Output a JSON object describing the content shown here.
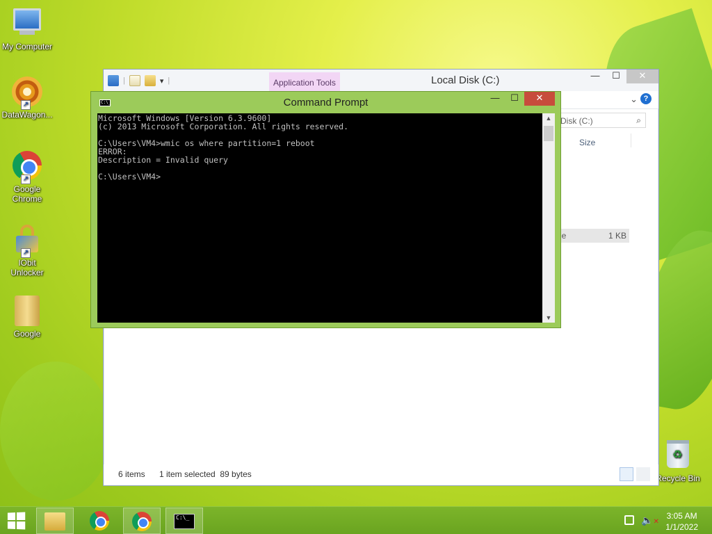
{
  "desktop": {
    "icons": [
      {
        "label": "My Computer"
      },
      {
        "label": "DataWagon..."
      },
      {
        "label": "Google Chrome"
      },
      {
        "label": "IObit Unlocker"
      },
      {
        "label": "Google"
      },
      {
        "label": "Recycle Bin"
      }
    ]
  },
  "explorer": {
    "contextual_tab": "Application Tools",
    "title": "Local Disk (C:)",
    "minimize": "—",
    "maximize": "☐",
    "close": "✕",
    "search_text": "Disk (C:)",
    "column_size": "Size",
    "selected_row": {
      "type_fragment": "le",
      "size": "1 KB"
    },
    "status": {
      "items": "6 items",
      "selection": "1 item selected  89 bytes"
    }
  },
  "cmd": {
    "title": "Command Prompt",
    "icon_text": "C:\\_",
    "minimize": "—",
    "maximize": "☐",
    "close": "✕",
    "console_lines": "Microsoft Windows [Version 6.3.9600]\n(c) 2013 Microsoft Corporation. All rights reserved.\n\nC:\\Users\\VM4>wmic os where partition=1 reboot\nERROR:\nDescription = Invalid query\n\nC:\\Users\\VM4>"
  },
  "taskbar": {
    "cmd_icon_text": "C:\\_",
    "clock_time": "3:05 AM",
    "clock_date": "1/1/2022"
  }
}
